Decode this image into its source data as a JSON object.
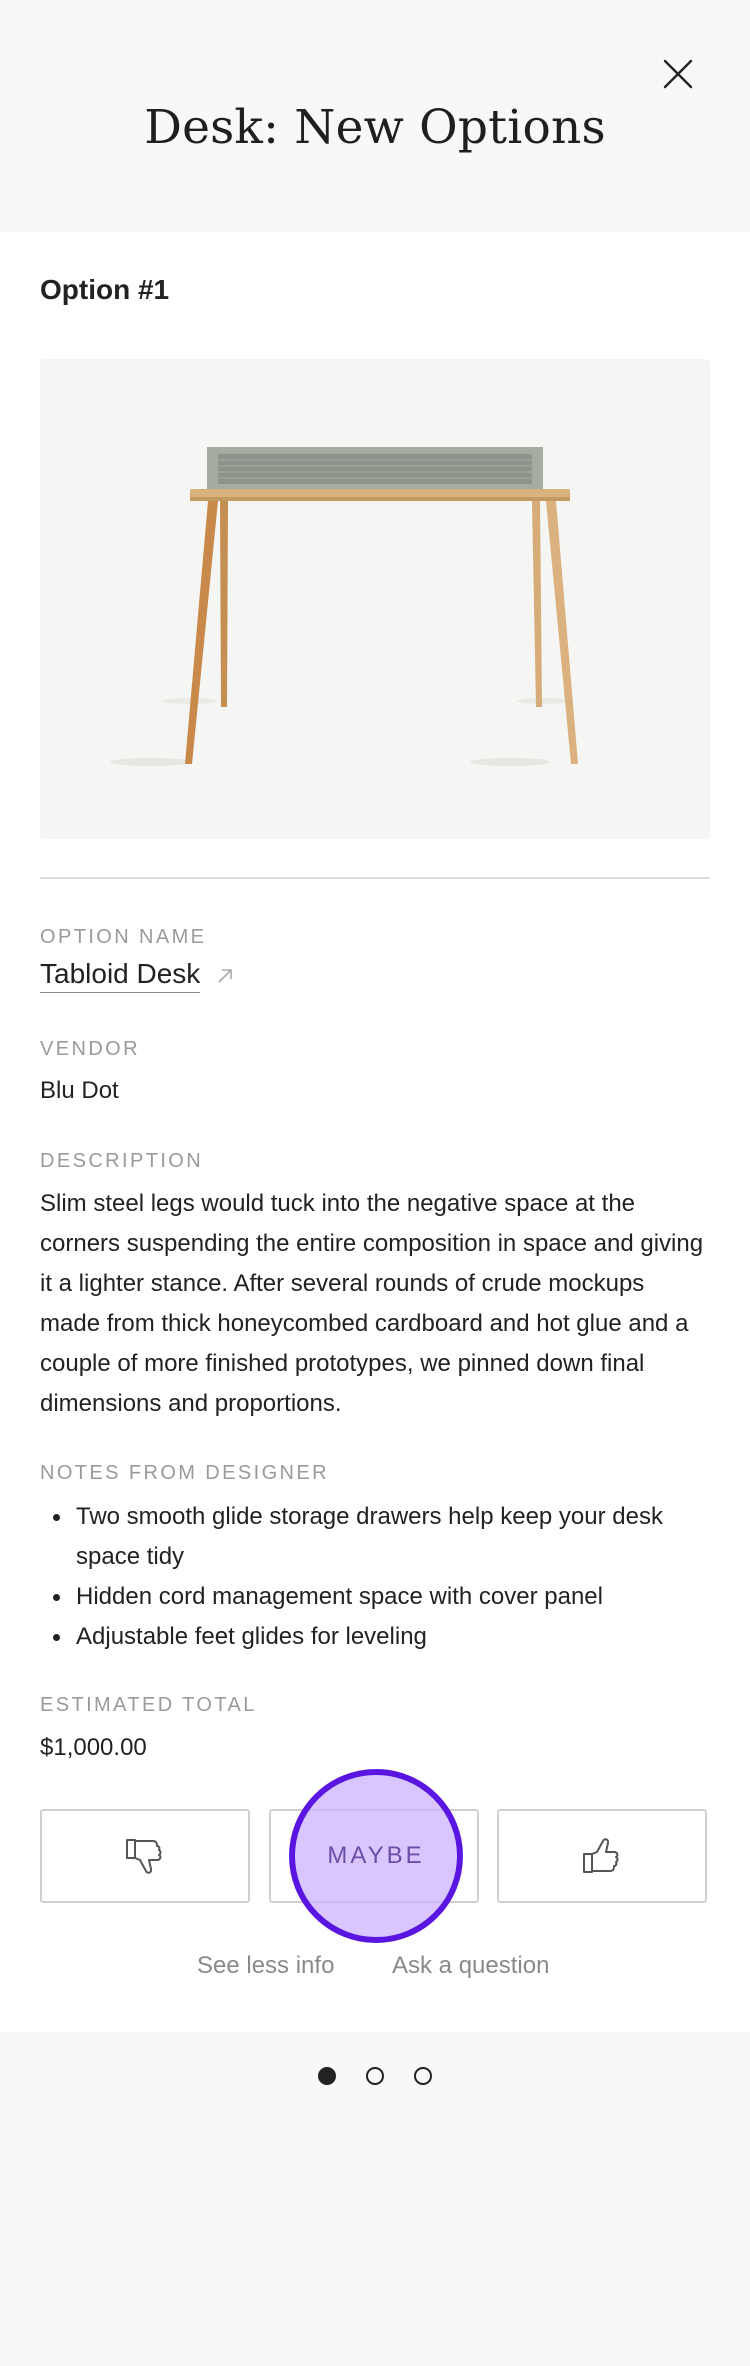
{
  "header": {
    "title": "Desk: New Options",
    "close_icon": "close-icon"
  },
  "option": {
    "heading": "Option #1",
    "image_alt": "desk-photo",
    "name_label": "OPTION NAME",
    "name": "Tabloid Desk",
    "vendor_label": "VENDOR",
    "vendor": "Blu Dot",
    "description_label": "DESCRIPTION",
    "description": "Slim steel legs would tuck into the negative space at the corners suspending the entire composition in space and giving it a lighter stance. After several rounds of crude mockups made from thick honeycombed cardboard and hot glue and a couple of more finished prototypes, we pinned down final dimensions and proportions.",
    "notes_label": "NOTES FROM DESIGNER",
    "notes": [
      "Two smooth glide storage drawers help keep your desk space tidy",
      "Hidden cord management space with cover panel",
      "Adjustable feet glides for leveling"
    ],
    "total_label": "ESTIMATED TOTAL",
    "total": "$1,000.00"
  },
  "actions": {
    "dislike_icon": "thumbs-down-icon",
    "maybe_label": "MAYBE",
    "like_icon": "thumbs-up-icon",
    "see_less": "See less info",
    "ask_question": "Ask a question"
  },
  "pager": {
    "total": 3,
    "current": 1
  },
  "colors": {
    "highlight_fill": "#cab0ff",
    "highlight_ring": "#5a16e0",
    "muted_text": "#9a9a9a"
  }
}
